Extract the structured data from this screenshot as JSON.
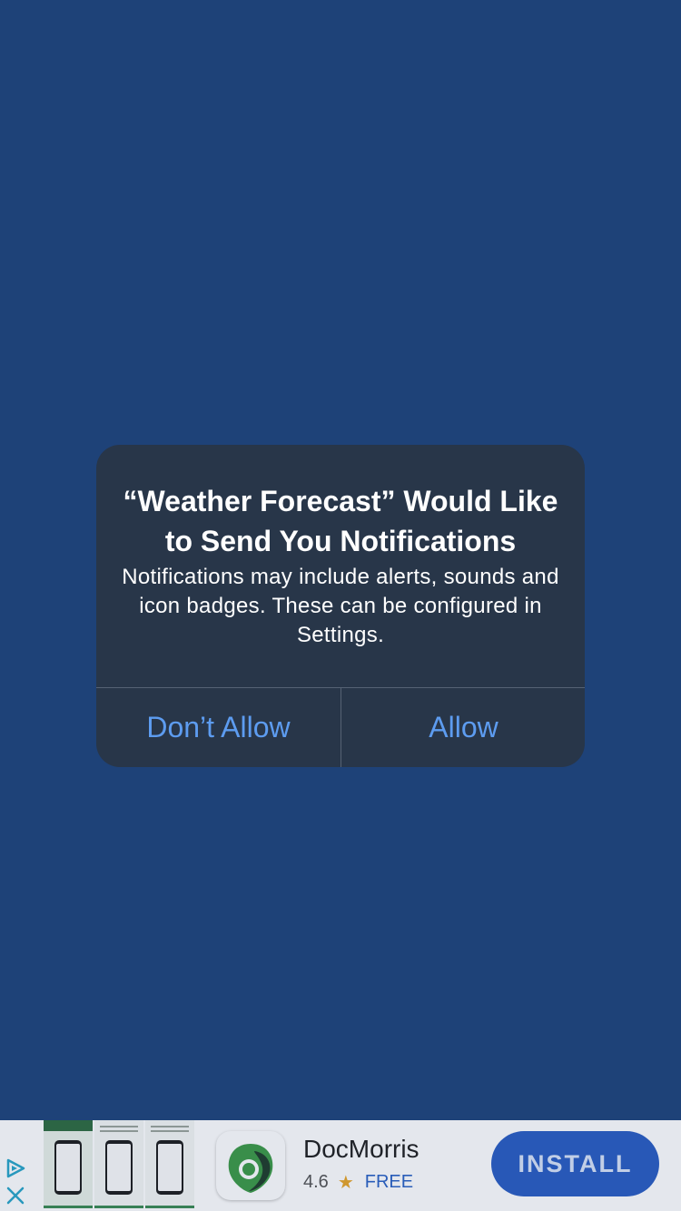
{
  "colors": {
    "background": "#1e4278",
    "alert_background": "#283649",
    "alert_button_text": "#5d9cf0",
    "install_button": "#2a5dc2",
    "star": "#e8a427"
  },
  "alert": {
    "title": "“Weather Forecast” Would Like to Send You Notifications",
    "message": "Notifications may include alerts, sounds and icon badges. These can be configured in Settings.",
    "deny_label": "Don’t Allow",
    "allow_label": "Allow"
  },
  "ad": {
    "choices_icon": "ad-choices-icon",
    "close_icon": "close-icon",
    "app_name": "DocMorris",
    "rating": "4.6",
    "rating_icon": "star-icon",
    "price": "FREE",
    "install_label": "INSTALL"
  }
}
